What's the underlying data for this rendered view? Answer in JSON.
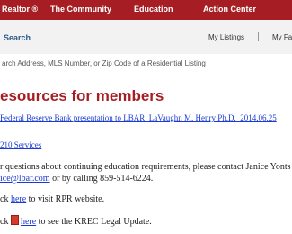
{
  "nav": {
    "items": [
      "Realtor ®",
      "The Community",
      "Education",
      "Action Center"
    ]
  },
  "search": {
    "tab_label": "Search",
    "my_listings": "My Listings",
    "my_fav": "My Fa",
    "placeholder": "arch Address, MLS Number, or Zip Code of a Residential Listing"
  },
  "content": {
    "title": "esources for members",
    "link1": "Federal Reserve Bank presentation to LBAR_LaVaughn M. Henry Ph.D._2014.06.25",
    "link2": "210 Services",
    "para1_line1": "r questions about continuing education requirements, please contact Janice Yonts b",
    "para1_email": "ice@lbar.com",
    "para1_line2_rest": " or by calling 859-514-6224.",
    "rpr_prefix": "ck ",
    "rpr_link": "here",
    "rpr_suffix": " to visit RPR website.",
    "krec_prefix": "ck ",
    "krec_link": "here",
    "krec_suffix": " to see the KREC Legal Update."
  }
}
